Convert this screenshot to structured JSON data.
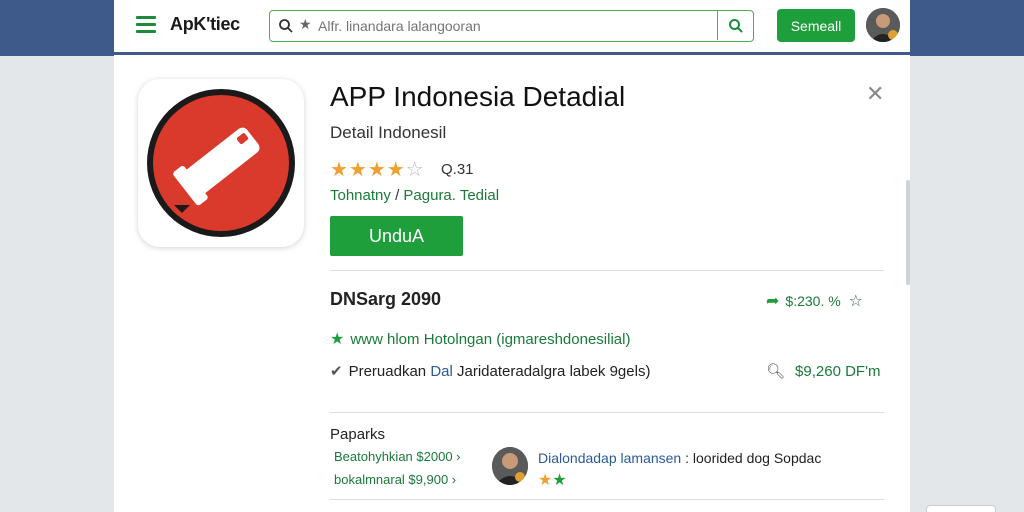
{
  "header": {
    "logo": "ApK'tiec",
    "search_placeholder": "Alfr. linandara lalangooran",
    "login_label": "Semeall"
  },
  "app": {
    "title": "APP Indonesia Detadial",
    "subtitle": "Detail Indonesil",
    "rating": "Q.31",
    "breadcrumb": [
      "Tohnatny",
      "Pagura. Tedial"
    ],
    "download_label": "UnduA"
  },
  "info": {
    "section_title": "DNSarg 2090",
    "price_top": "$:230. %",
    "feature1": "www hlom Hotolngan (igmareshdonesilial)",
    "feature2_a": "Preruadkan",
    "feature2_b": "Dal",
    "feature2_c": "Jaridateradalgra labek 9gels)",
    "price_bottom": "$9,260 DF'm"
  },
  "reviews": {
    "heading": "Paparks",
    "item1": "Beatohyhkian $2000 ›",
    "item2": "bokalmnaral $9,900 ›",
    "review_name": "Dialondadap lamansen",
    "review_text": ": loorided dog Sopdac"
  },
  "colors": {
    "accent": "#1f9e3c",
    "topbar": "#3d5a8a",
    "icon_red": "#d93a2b",
    "star": "#f0a030"
  }
}
